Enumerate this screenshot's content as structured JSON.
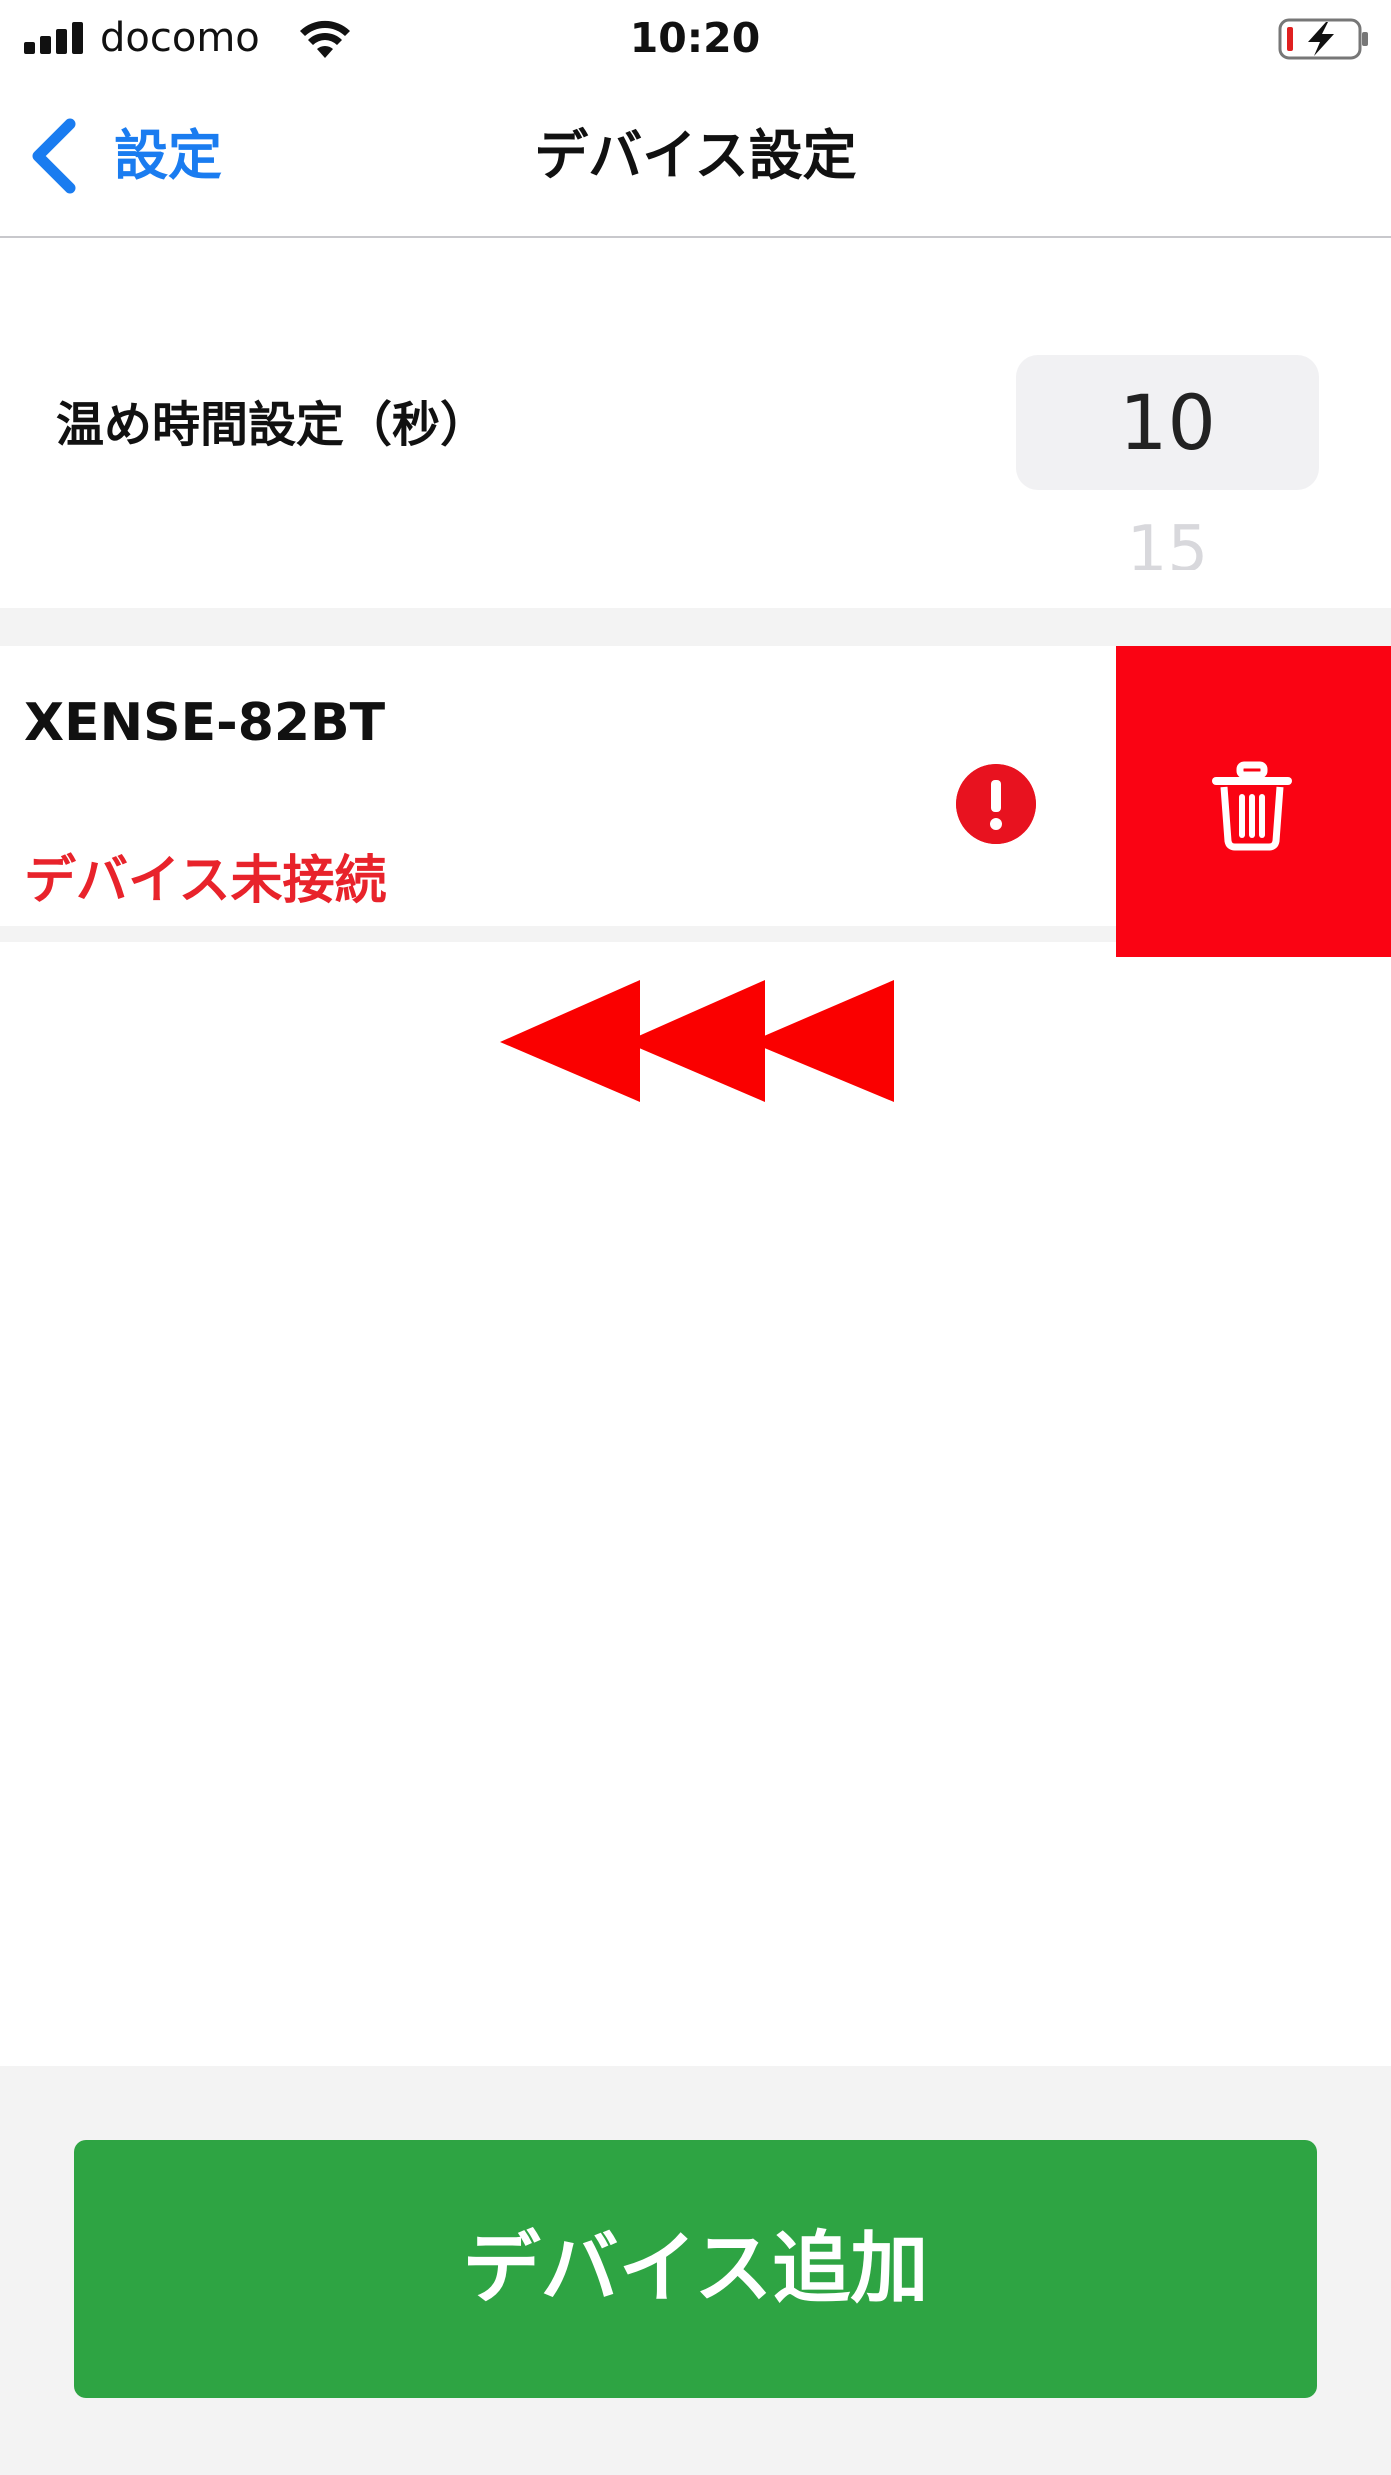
{
  "status_bar": {
    "carrier": "docomo",
    "time": "10:20",
    "signal_icon": "cellular-signal-icon",
    "wifi_icon": "wifi-icon",
    "battery_icon": "battery-charging-icon"
  },
  "nav": {
    "back_label": "設定",
    "title": "デバイス設定",
    "back_icon": "chevron-left-icon"
  },
  "warm_time": {
    "label": "温め時間設定（秒）",
    "selected_value": "10",
    "next_value": "15"
  },
  "device": {
    "name": "XENSE-82BT",
    "status": "デバイス未接続",
    "alert_icon": "exclamation-circle-icon",
    "delete_icon": "trash-icon"
  },
  "footer": {
    "add_device_label": "デバイス追加"
  },
  "colors": {
    "accent_blue": "#1a7cf0",
    "delete_red": "#fa0313",
    "status_red": "#e8232b",
    "add_green": "#2ea443"
  }
}
